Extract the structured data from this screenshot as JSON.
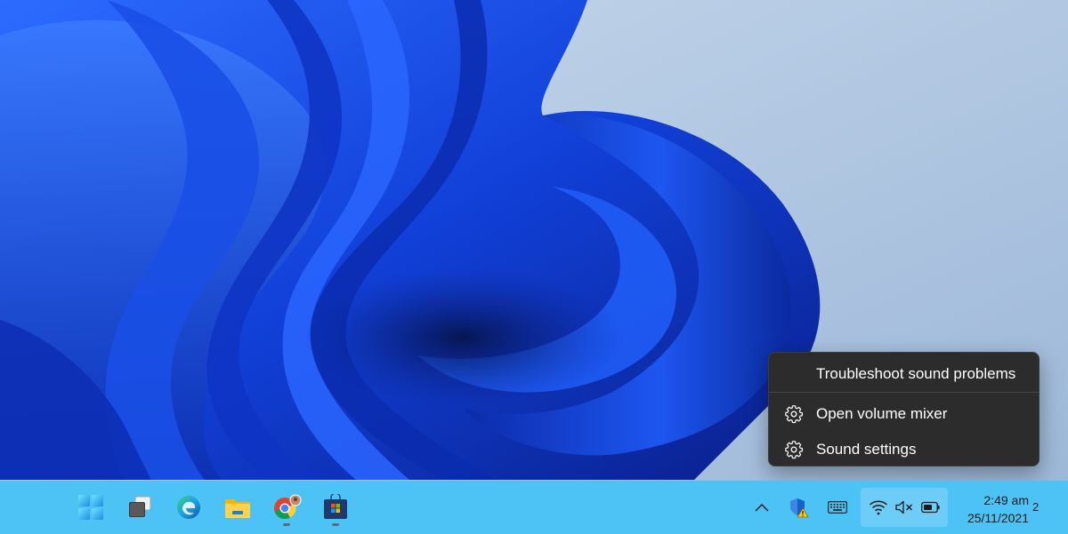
{
  "context_menu": {
    "items": [
      {
        "label": "Troubleshoot sound problems",
        "icon": ""
      },
      {
        "label": "Open volume mixer",
        "icon": "gear-icon"
      },
      {
        "label": "Sound settings",
        "icon": "gear-icon"
      }
    ]
  },
  "taskbar": {
    "apps": [
      {
        "name": "start",
        "icon": "windows-start-icon"
      },
      {
        "name": "task-view",
        "icon": "task-view-icon"
      },
      {
        "name": "edge",
        "icon": "edge-icon"
      },
      {
        "name": "file-explorer",
        "icon": "folder-icon"
      },
      {
        "name": "chrome",
        "icon": "chrome-icon",
        "running": true
      },
      {
        "name": "store",
        "icon": "store-icon",
        "running": true
      }
    ],
    "tray": {
      "chevron": "chevron-up-icon",
      "security": "defender-shield-warning-icon",
      "keyboard": "keyboard-icon",
      "wifi": "wifi-icon",
      "volume": "volume-muted-icon",
      "battery": "battery-icon"
    },
    "clock": {
      "time": "2:49 am",
      "date": "25/11/2021"
    },
    "notification_count": "2"
  },
  "colors": {
    "taskbar": "#4dc2f5",
    "menu_background": "#2c2c2c",
    "menu_text": "#ffffff"
  }
}
